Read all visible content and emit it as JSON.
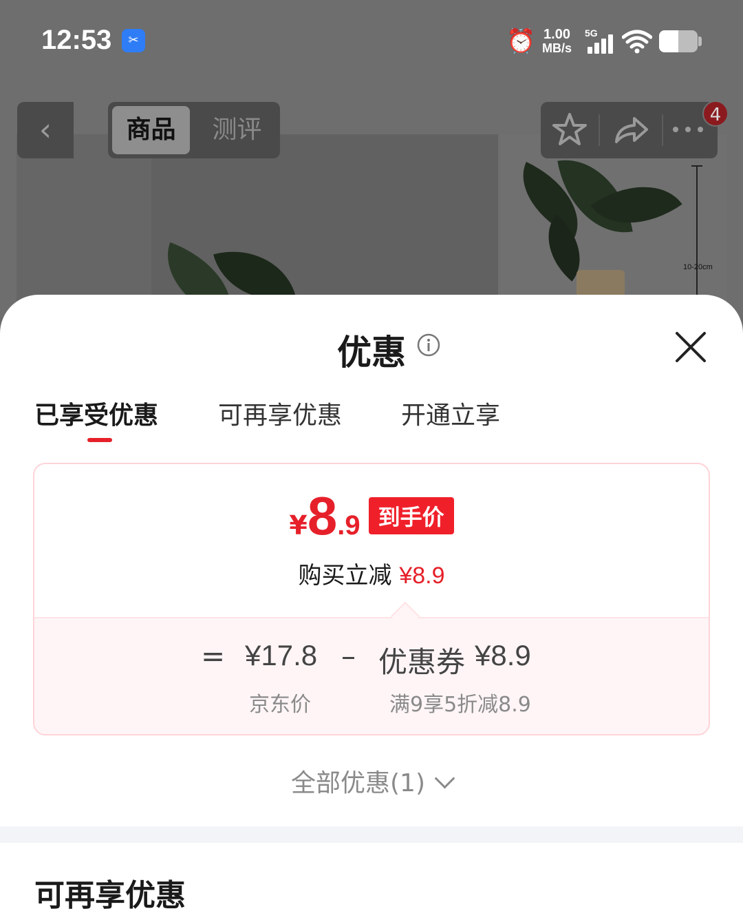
{
  "status_bar": {
    "time": "12:53",
    "net_speed_value": "1.00",
    "net_speed_unit": "MB/s",
    "network_type": "5G",
    "battery_level": 0.5
  },
  "nav": {
    "seg_product": "商品",
    "seg_review": "测评",
    "badge_count": "4"
  },
  "background": {
    "measure_label": "10-20cm"
  },
  "sheet": {
    "title": "优惠",
    "tabs": [
      {
        "label": "已享受优惠"
      },
      {
        "label": "可再享优惠"
      },
      {
        "label": "开通立享"
      }
    ],
    "card": {
      "currency": "¥",
      "price_int": "8",
      "price_dec": ".9",
      "price_tag": "到手价",
      "reduce_label": "购买立减",
      "reduce_amount": "¥8.9",
      "eq": "=",
      "base_price": "¥17.8",
      "minus": "–",
      "coupon_label": "优惠券",
      "coupon_amount": "¥8.9",
      "base_price_label": "京东价",
      "coupon_desc": "满9享5折减8.9"
    },
    "all_offers": "全部优惠(1)",
    "section_title": "可再享优惠"
  },
  "colors": {
    "accent_red": "#e6202a",
    "card_border": "#ffd3d8"
  }
}
